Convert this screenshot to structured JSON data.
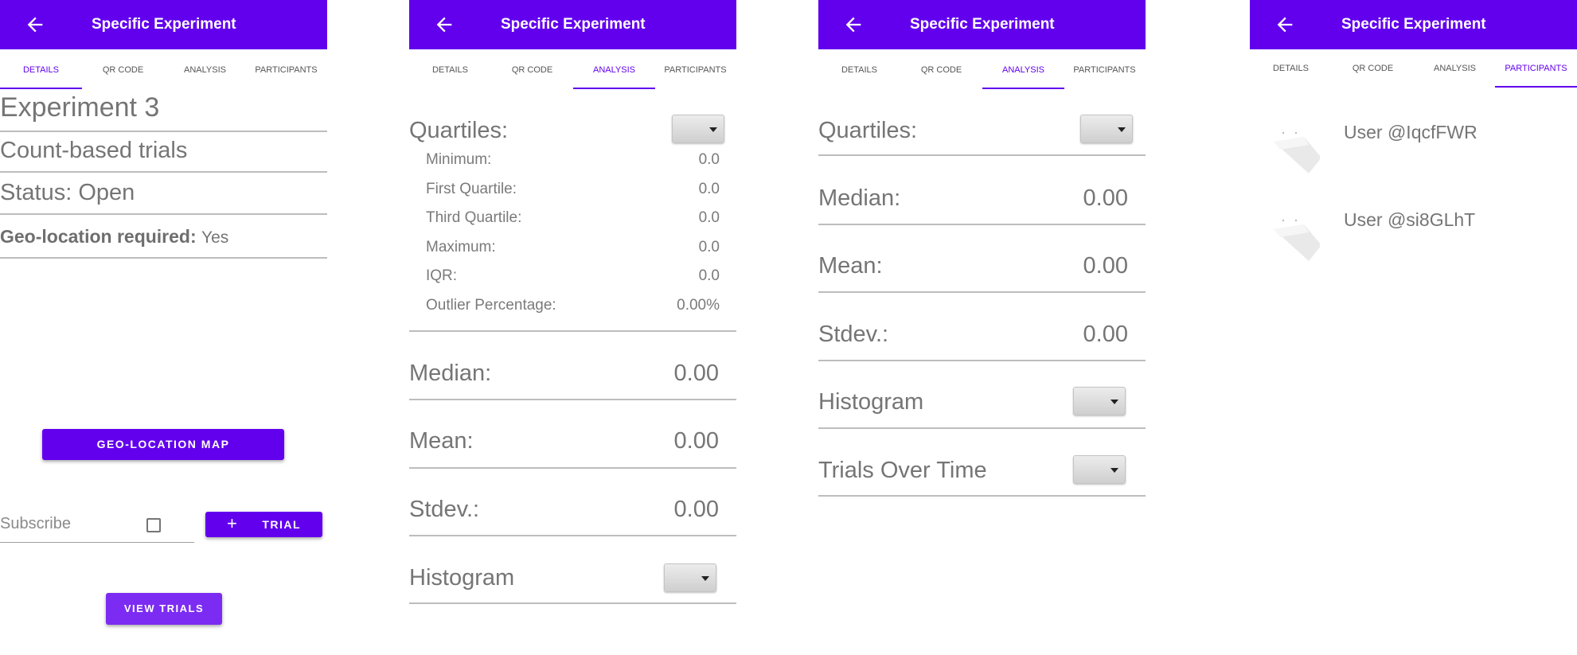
{
  "colors": {
    "primary": "#6200ee",
    "text": "#757575"
  },
  "appbar": {
    "title": "Specific Experiment",
    "back_icon": "arrow-left-icon"
  },
  "tabs": [
    "DETAILS",
    "QR CODE",
    "ANALYSIS",
    "PARTICIPANTS"
  ],
  "details": {
    "title": "Experiment 3",
    "type": "Count-based trials",
    "status": "Status: Open",
    "geo_label": "Geo-location required:",
    "geo_value": "Yes",
    "geo_map_button": "GEO-LOCATION MAP",
    "subscribe_label": "Subscribe",
    "subscribed": false,
    "trial_button": "TRIAL",
    "view_trials_button": "VIEW TRIALS"
  },
  "analysis_expanded": {
    "quartiles_label": "Quartiles:",
    "quartiles": [
      {
        "label": "Minimum:",
        "value": "0.0"
      },
      {
        "label": "First Quartile:",
        "value": "0.0"
      },
      {
        "label": "Third Quartile:",
        "value": "0.0"
      },
      {
        "label": "Maximum:",
        "value": "0.0"
      },
      {
        "label": "IQR:",
        "value": "0.0"
      },
      {
        "label": "Outlier Percentage:",
        "value": "0.00%"
      }
    ],
    "median_label": "Median:",
    "median": "0.00",
    "mean_label": "Mean:",
    "mean": "0.00",
    "stdev_label": "Stdev.:",
    "stdev": "0.00",
    "histogram_label": "Histogram"
  },
  "analysis_collapsed": {
    "quartiles_label": "Quartiles:",
    "median_label": "Median:",
    "median": "0.00",
    "mean_label": "Mean:",
    "mean": "0.00",
    "stdev_label": "Stdev.:",
    "stdev": "0.00",
    "histogram_label": "Histogram",
    "trials_over_time_label": "Trials Over Time"
  },
  "participants": [
    {
      "name": "User @IqcfFWR"
    },
    {
      "name": "User @si8GLhT"
    }
  ]
}
